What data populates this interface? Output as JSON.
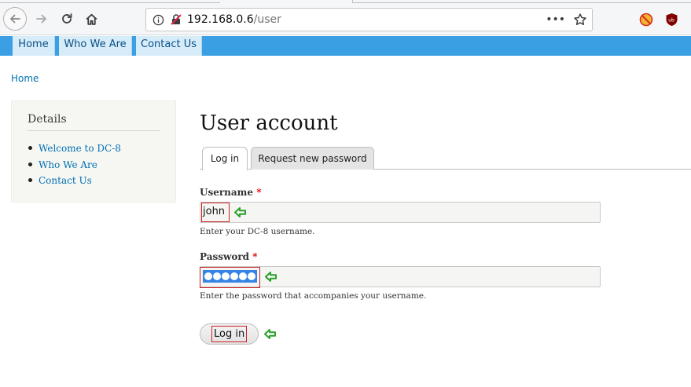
{
  "browser": {
    "url_host": "192.168.0.6",
    "url_path": "/user",
    "more_label": "•••"
  },
  "site_nav": {
    "items": [
      "Home",
      "Who We Are",
      "Contact Us"
    ]
  },
  "breadcrumb": {
    "home": "Home"
  },
  "sidebar": {
    "title": "Details",
    "items": [
      "Welcome to DC-8",
      "Who We Are",
      "Contact Us"
    ]
  },
  "main": {
    "title": "User account",
    "tabs": [
      "Log in",
      "Request new password"
    ],
    "username": {
      "label": "Username",
      "required_mark": "*",
      "value": "john",
      "description": "Enter your DC-8 username."
    },
    "password": {
      "label": "Password",
      "required_mark": "*",
      "masked_length": 6,
      "description": "Enter the password that accompanies your username."
    },
    "submit_label": "Log in"
  },
  "colors": {
    "nav_bar": "#3aa0e3",
    "link": "#0071b3",
    "annotation_box": "#cc2020",
    "annotation_arrow": "#2aa02a"
  },
  "icons": {
    "back": "arrow-left-icon",
    "forward": "arrow-right-icon",
    "reload": "reload-icon",
    "home": "home-icon",
    "info": "info-icon",
    "insecure": "insecure-lock-icon",
    "bookmark": "star-icon",
    "ext1": "extension-icon",
    "ext2": "ublock-icon",
    "annotation": "green-arrow-left-icon"
  }
}
